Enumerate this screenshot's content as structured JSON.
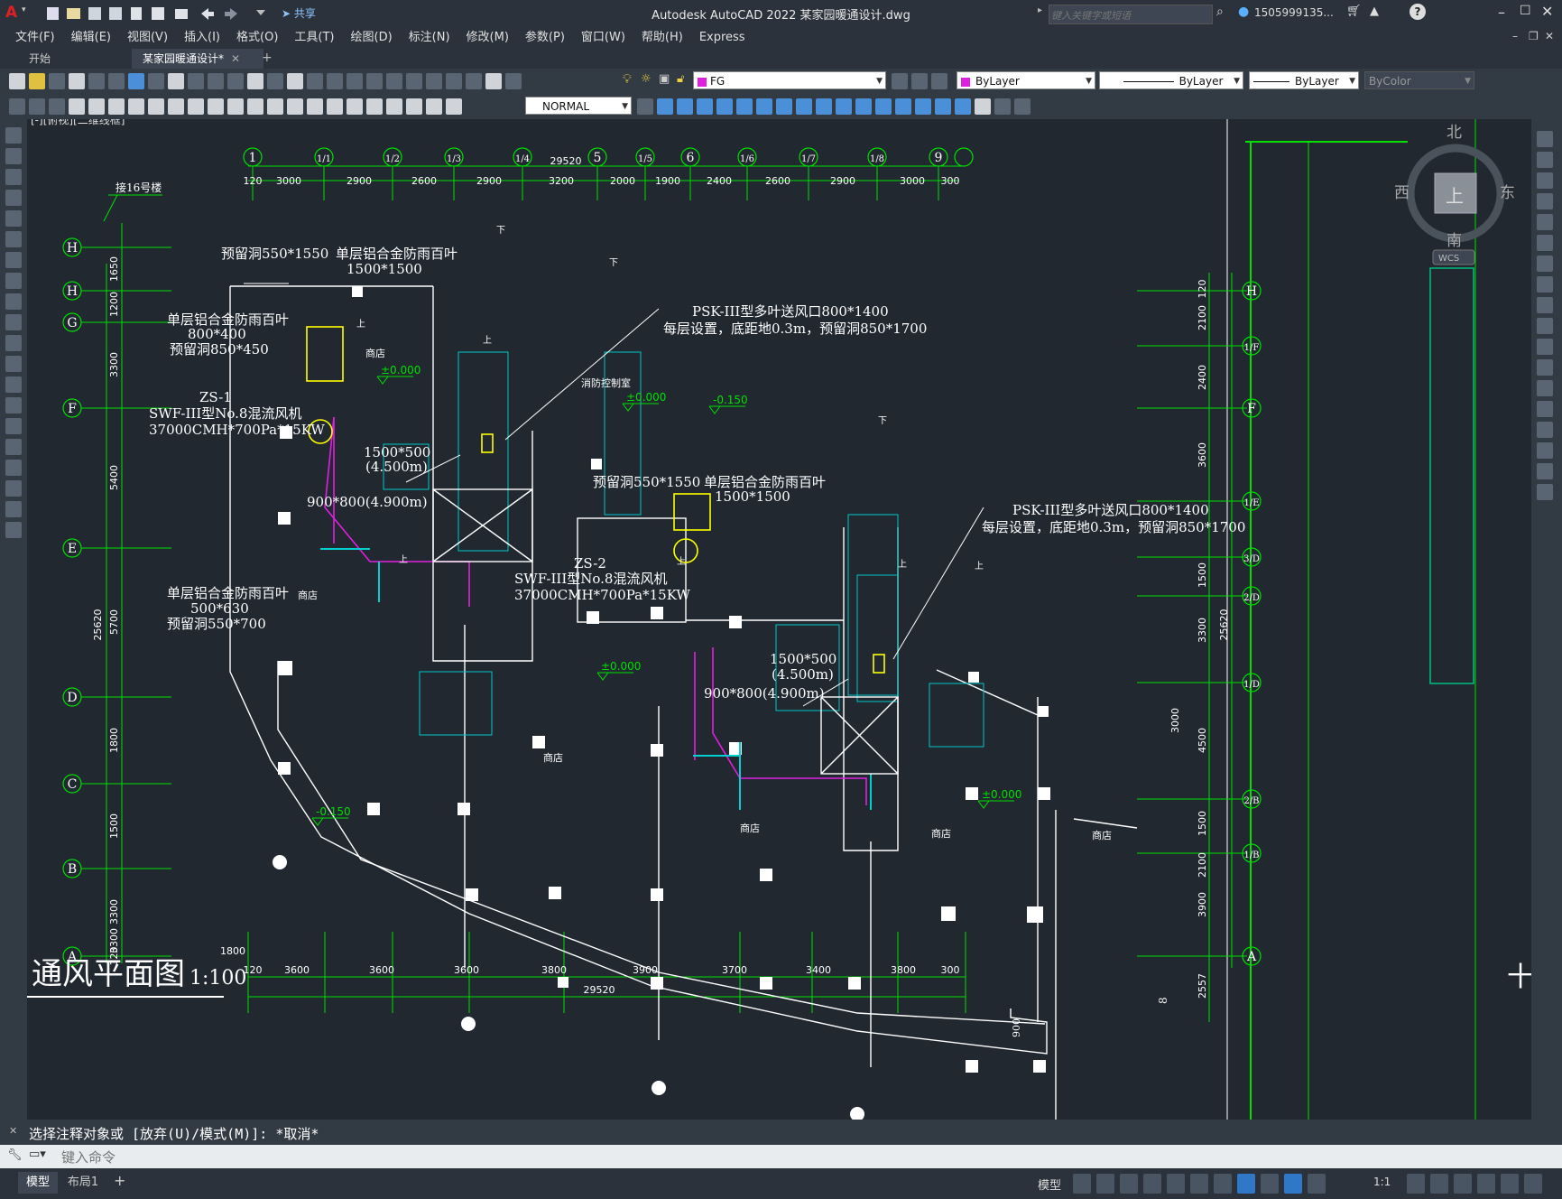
{
  "app": {
    "title": "Autodesk AutoCAD 2022    某家园暖通设计.dwg",
    "share_label": "共享",
    "search_placeholder": "键入关键字或短语",
    "user": "1505999135...",
    "help": "?"
  },
  "menu": [
    "文件(F)",
    "编辑(E)",
    "视图(V)",
    "插入(I)",
    "格式(O)",
    "工具(T)",
    "绘图(D)",
    "标注(N)",
    "修改(M)",
    "参数(P)",
    "窗口(W)",
    "帮助(H)",
    "Express"
  ],
  "tabs": [
    {
      "label": "开始"
    },
    {
      "label": "某家园暖通设计*"
    }
  ],
  "toolbar": {
    "layer": "FG",
    "color": "ByLayer",
    "linetype": "ByLayer",
    "lineweight": "ByLayer",
    "plotstyle": "ByColor",
    "dimstyle": "NORMAL"
  },
  "viewport_label": "[-][俯视][二维线框]",
  "viewcube": {
    "north": "北",
    "south": "南",
    "east": "东",
    "west": "西",
    "top": "上",
    "wcs": "WCS"
  },
  "drawing": {
    "axes_top": [
      "1",
      "1/1",
      "1/2",
      "1/3",
      "1/4",
      "5",
      "1/5",
      "6",
      "1/6",
      "1/7",
      "1/8",
      "9"
    ],
    "dims_top": [
      "120",
      "3000",
      "2900",
      "2600",
      "2900",
      "3200",
      "2000",
      "1900",
      "2400",
      "2600",
      "2900",
      "3000",
      "300"
    ],
    "total_top": "29520",
    "dims_bottom": [
      "120",
      "3600",
      "3600",
      "3600",
      "3800",
      "3900",
      "3700",
      "3400",
      "3800",
      "300"
    ],
    "total_bottom": "29520",
    "dim_1800": "1800",
    "axes_left": [
      "H",
      "H",
      "G",
      "F",
      "E",
      "D",
      "C",
      "B",
      "A"
    ],
    "dims_left": [
      "1650",
      "1200",
      "3300",
      "5400",
      "5700",
      "1800",
      "1500",
      "3300",
      "3300",
      "120"
    ],
    "total_left": "25620",
    "axes_right": [
      "H",
      "1/F",
      "F",
      "1/E",
      "3/D",
      "2/D",
      "1/D",
      "2/B",
      "1/B",
      "A"
    ],
    "dims_right": [
      "120",
      "2100",
      "2400",
      "3600",
      "1500",
      "3300",
      "4500",
      "1500",
      "2100",
      "3900",
      "2557"
    ],
    "dim_right_3000": "3000",
    "total_right": "25620",
    "label_bldg": "接16号楼",
    "notes": [
      "预留洞550*1550",
      "单层铝合金防雨百叶",
      "1500*1500",
      "单层铝合金防雨百叶",
      "800*400",
      "预留洞850*450",
      "ZS-1",
      "SWF-III型No.8混流风机",
      "37000CMH*700Pa*15KW",
      "1500*500",
      "(4.500m)",
      "900*800(4.900m)",
      "单层铝合金防雨百叶",
      "500*630",
      "预留洞550*700",
      "PSK-III型多叶送风口800*1400",
      "每层设置，底距地0.3m，预留洞850*1700",
      "预留洞550*1550",
      "单层铝合金防雨百叶",
      "1500*1500",
      "ZS-2",
      "SWF-III型No.8混流风机",
      "37000CMH*700Pa*15KW",
      "PSK-III型多叶送风口800*1400",
      "每层设置，底距地0.3m，预留洞850*1700",
      "1500*500",
      "(4.500m)",
      "900*800(4.900m)"
    ],
    "rooms": [
      "商店",
      "商店",
      "商店",
      "商店",
      "商店",
      "商店",
      "消防控制室"
    ],
    "levels": [
      "±0.000",
      "±0.000",
      "±0.000",
      "±0.000",
      "-0.150",
      "-0.150"
    ],
    "stairs_up": "上",
    "stairs_down": "下",
    "plan_title": "通风平面图",
    "plan_scale": "1:100",
    "dim_900": "900",
    "dim_8": "8"
  },
  "command": {
    "history": "选择注释对象或 [放弃(U)/模式(M)]: *取消*",
    "placeholder": "键入命令"
  },
  "layout_tabs": [
    "模型",
    "布局1"
  ],
  "status": {
    "model": "模型",
    "scale": "1:1"
  },
  "colors": {
    "accent": "#2f78c8",
    "axis": "#00e000",
    "cyan": "#00d0d0",
    "magenta": "#e020e0",
    "yellow": "#ffff00",
    "bg": "#212830"
  }
}
